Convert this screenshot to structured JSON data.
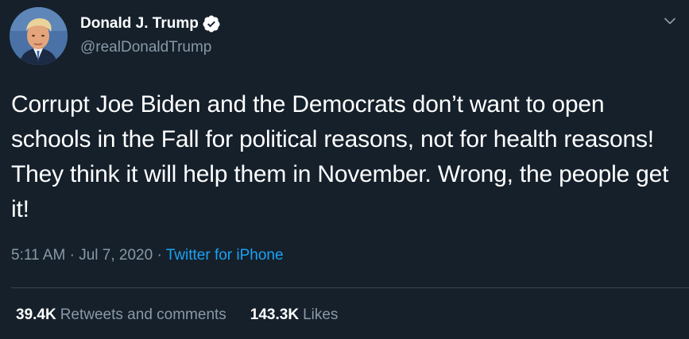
{
  "user": {
    "display_name": "Donald J. Trump",
    "handle": "@realDonaldTrump",
    "verified_icon": "verified-badge-icon",
    "avatar_icon": "profile-avatar"
  },
  "tweet": {
    "text": "Corrupt Joe Biden and the Democrats don’t want to open schools in the Fall for political reasons, not for health reasons! They think it will help them in November. Wrong, the people get it!",
    "time": "5:11 AM",
    "separator": "·",
    "date": "Jul 7, 2020",
    "source": "Twitter for iPhone"
  },
  "stats": {
    "retweets_count": "39.4K",
    "retweets_label": "Retweets and comments",
    "likes_count": "143.3K",
    "likes_label": "Likes"
  },
  "colors": {
    "background": "#15202b",
    "text_primary": "#ffffff",
    "text_secondary": "#8899a6",
    "link": "#1da1f2",
    "divider": "#38444d"
  }
}
